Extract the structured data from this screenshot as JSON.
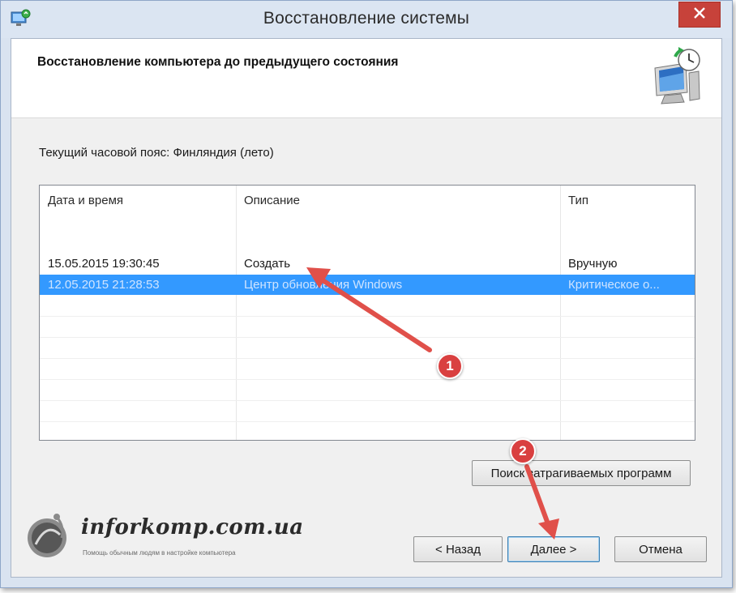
{
  "window": {
    "title": "Восстановление системы"
  },
  "header": {
    "title": "Восстановление компьютера до предыдущего состояния"
  },
  "timezone_label": "Текущий часовой пояс: Финляндия (лето)",
  "restore_points": {
    "columns": [
      "Дата и время",
      "Описание",
      "Тип"
    ],
    "rows": [
      {
        "date": "15.05.2015 19:30:45",
        "description": "Создать",
        "type": "Вручную",
        "selected": false
      },
      {
        "date": "12.05.2015 21:28:53",
        "description": "Центр обновления Windows",
        "type": "Критическое о...",
        "selected": true
      }
    ]
  },
  "buttons": {
    "scan": "Поиск затрагиваемых программ",
    "back": "< Назад",
    "next": "Далее >",
    "cancel": "Отмена"
  },
  "annotations": {
    "badge1": "1",
    "badge2": "2",
    "arrow_color": "#e0504a"
  },
  "watermark": {
    "text": "inforkomp.com.ua",
    "tagline": "Помощь обычным людям в настройке компьютера"
  },
  "colors": {
    "selection": "#3399ff",
    "close_button": "#c7423a"
  }
}
